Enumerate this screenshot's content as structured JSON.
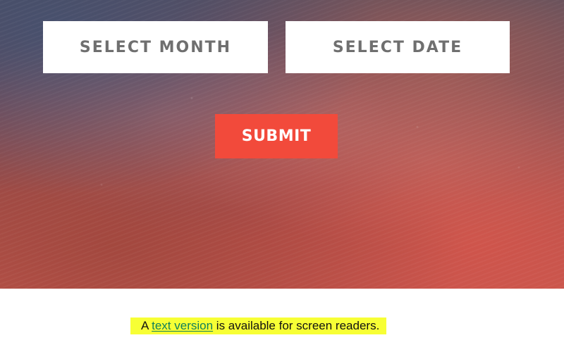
{
  "hero": {
    "select_month_label": "SELECT MONTH",
    "select_date_label": "SELECT DATE",
    "submit_label": "SUBMIT"
  },
  "footer": {
    "prefix": "A ",
    "link_text": "text version",
    "suffix": " is available for screen readers."
  },
  "colors": {
    "submit_bg": "#f24a3b",
    "select_bg": "#ffffff",
    "select_text": "#6f6f6f",
    "note_highlight": "#f7ff35",
    "link": "#117f5a"
  }
}
